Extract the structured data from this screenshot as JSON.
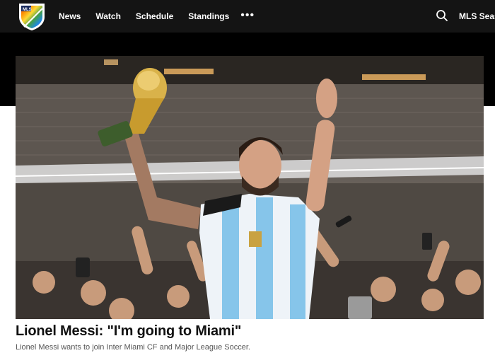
{
  "nav": {
    "logo_icon": "mls-pride-crest-icon",
    "links": [
      "News",
      "Watch",
      "Schedule",
      "Standings"
    ],
    "more_label": "•••",
    "search_icon": "search-icon",
    "season_label": "MLS Season"
  },
  "hero": {
    "image_description_icon": "player-with-trophy-photo"
  },
  "article": {
    "headline": "Lionel Messi: \"I'm going to Miami\"",
    "subtitle": "Lionel Messi wants to join Inter Miami CF and Major League Soccer."
  },
  "colors": {
    "nav_bg": "#141414",
    "band_bg": "#000000",
    "headline": "#111111",
    "subtitle": "#555555"
  }
}
